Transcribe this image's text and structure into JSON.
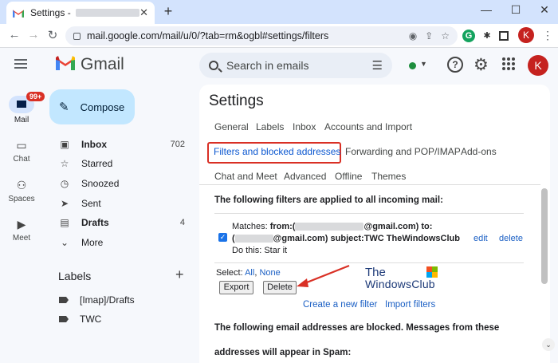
{
  "browser": {
    "tab_title": "Settings -",
    "tab_close": "✕",
    "new_tab": "+",
    "url": "mail.google.com/mail/u/0/?tab=rm&ogbl#settings/filters",
    "profile_letter": "K",
    "window_controls": {
      "minimize": "—",
      "maximize": "☐",
      "close": "✕"
    }
  },
  "app": {
    "name": "Gmail",
    "search_placeholder": "Search in emails",
    "avatar_letter": "K",
    "help_glyph": "?"
  },
  "rail": {
    "mail": {
      "label": "Mail",
      "badge": "99+"
    },
    "chat": {
      "label": "Chat"
    },
    "spaces": {
      "label": "Spaces"
    },
    "meet": {
      "label": "Meet"
    }
  },
  "compose": {
    "label": "Compose"
  },
  "nav": {
    "inbox": {
      "label": "Inbox",
      "count": "702"
    },
    "starred": {
      "label": "Starred"
    },
    "snoozed": {
      "label": "Snoozed"
    },
    "sent": {
      "label": "Sent"
    },
    "drafts": {
      "label": "Drafts",
      "count": "4"
    },
    "more": {
      "label": "More"
    }
  },
  "labels": {
    "heading": "Labels",
    "add_glyph": "+",
    "items": [
      "[Imap]/Drafts",
      "TWC"
    ]
  },
  "settings": {
    "title": "Settings",
    "tabs": {
      "general": "General",
      "labels": "Labels",
      "inbox": "Inbox",
      "accounts": "Accounts and Import",
      "filters": "Filters and blocked addresses",
      "forwarding": "Forwarding and POP/IMAP",
      "addons": "Add-ons",
      "chat": "Chat and Meet",
      "advanced": "Advanced",
      "offline": "Offline",
      "themes": "Themes"
    },
    "filters_heading": "The following filters are applied to all incoming mail:",
    "filter": {
      "matches_prefix": "Matches: ",
      "from_label": "from:(",
      "from_suffix": "@gmail.com) to:",
      "to_prefix": "(",
      "to_suffix": "@gmail.com) subject:TWC TheWindowsClub",
      "edit": "edit",
      "delete": "delete",
      "action": "Do this: Star it"
    },
    "select_label": "Select: ",
    "select_all": "All",
    "select_none": "None",
    "export_button": "Export",
    "delete_button": "Delete",
    "create_filter": "Create a new filter",
    "import_filters": "Import filters",
    "blocked_line1": "The following email addresses are blocked. Messages from these",
    "blocked_line2": "addresses will appear in Spam:"
  },
  "watermark": {
    "line1": "The",
    "line2": "WindowsClub"
  },
  "colors": {
    "accent": "#0b57d0",
    "highlight_box": "#d93025",
    "compose_bg": "#c2e7ff",
    "app_bg": "#f6f8fc"
  }
}
